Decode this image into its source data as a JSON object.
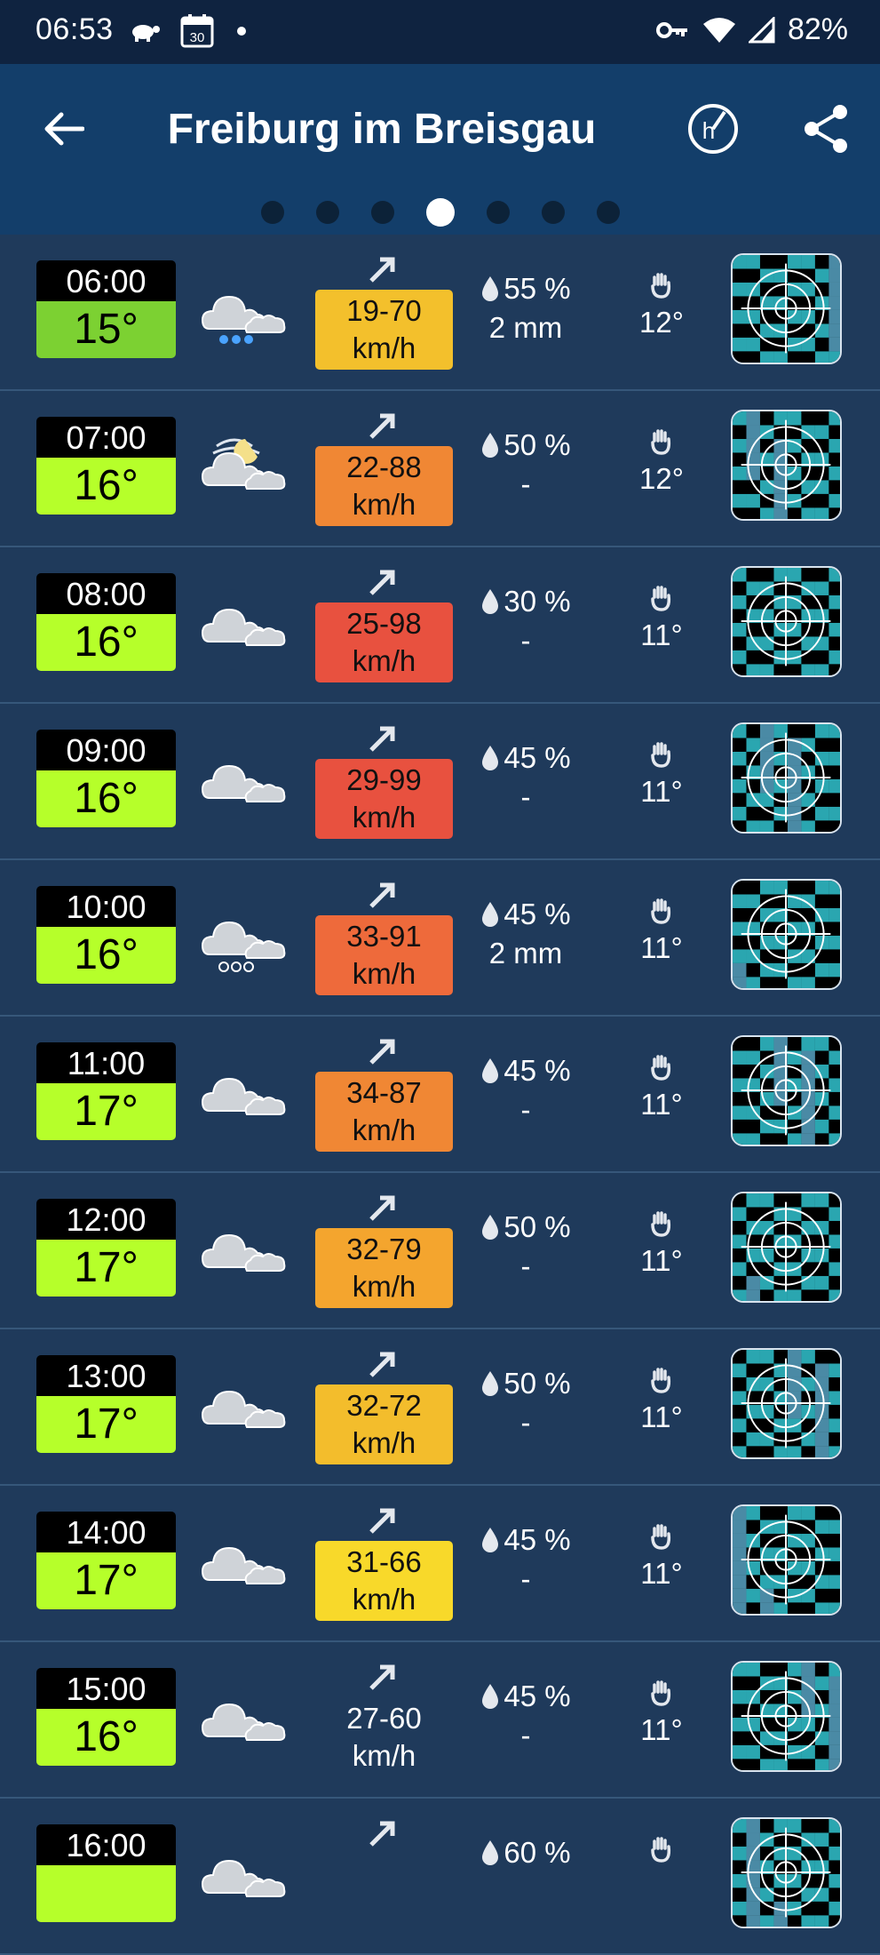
{
  "status": {
    "time": "06:53",
    "battery": "82%",
    "calendar_day": "30"
  },
  "header": {
    "title": "Freiburg im Breisgau",
    "page_count": 7,
    "active_page": 4
  },
  "colors": {
    "temp_green": "#b6ff2a",
    "temp_darkgreen": "#7cd132",
    "wind_yellow": "#f6c12b",
    "wind_orange": "#f08a33",
    "wind_red": "#e8503e",
    "wind_light_orange": "#f3a32e",
    "wind_gold": "#f8d92a"
  },
  "rows": [
    {
      "time": "06:00",
      "temp": "15°",
      "icon": "snow-cloud-icon",
      "wind": "19-70",
      "unit": "km/h",
      "wind_color": "#f3c02c",
      "rain_pct": "55 %",
      "rain_amt": "2 mm",
      "feels": "12°"
    },
    {
      "time": "07:00",
      "temp": "16°",
      "icon": "night-windy-cloud-icon",
      "wind": "22-88",
      "unit": "km/h",
      "wind_color": "#f08734",
      "rain_pct": "50 %",
      "rain_amt": "-",
      "feels": "12°"
    },
    {
      "time": "08:00",
      "temp": "16°",
      "icon": "cloud-icon",
      "wind": "25-98",
      "unit": "km/h",
      "wind_color": "#e8513f",
      "rain_pct": "30 %",
      "rain_amt": "-",
      "feels": "11°"
    },
    {
      "time": "09:00",
      "temp": "16°",
      "icon": "cloud-icon",
      "wind": "29-99",
      "unit": "km/h",
      "wind_color": "#e8513f",
      "rain_pct": "45 %",
      "rain_amt": "-",
      "feels": "11°"
    },
    {
      "time": "10:00",
      "temp": "16°",
      "icon": "hail-cloud-icon",
      "wind": "33-91",
      "unit": "km/h",
      "wind_color": "#ee6a3b",
      "rain_pct": "45 %",
      "rain_amt": "2 mm",
      "feels": "11°"
    },
    {
      "time": "11:00",
      "temp": "17°",
      "icon": "cloud-icon",
      "wind": "34-87",
      "unit": "km/h",
      "wind_color": "#f08734",
      "rain_pct": "45 %",
      "rain_amt": "-",
      "feels": "11°"
    },
    {
      "time": "12:00",
      "temp": "17°",
      "icon": "cloud-icon",
      "wind": "32-79",
      "unit": "km/h",
      "wind_color": "#f4a52e",
      "rain_pct": "50 %",
      "rain_amt": "-",
      "feels": "11°"
    },
    {
      "time": "13:00",
      "temp": "17°",
      "icon": "cloud-icon",
      "wind": "32-72",
      "unit": "km/h",
      "wind_color": "#f3bd2c",
      "rain_pct": "50 %",
      "rain_amt": "-",
      "feels": "11°"
    },
    {
      "time": "14:00",
      "temp": "17°",
      "icon": "cloud-icon",
      "wind": "31-66",
      "unit": "km/h",
      "wind_color": "#f8d92a",
      "rain_pct": "45 %",
      "rain_amt": "-",
      "feels": "11°"
    },
    {
      "time": "15:00",
      "temp": "16°",
      "icon": "cloud-icon",
      "wind": "27-60",
      "unit": "km/h",
      "wind_color": "",
      "rain_pct": "45 %",
      "rain_amt": "-",
      "feels": "11°"
    },
    {
      "time": "16:00",
      "temp": "",
      "icon": "cloud-icon",
      "wind": "",
      "unit": "",
      "wind_color": "",
      "rain_pct": "60 %",
      "rain_amt": "",
      "feels": ""
    }
  ]
}
